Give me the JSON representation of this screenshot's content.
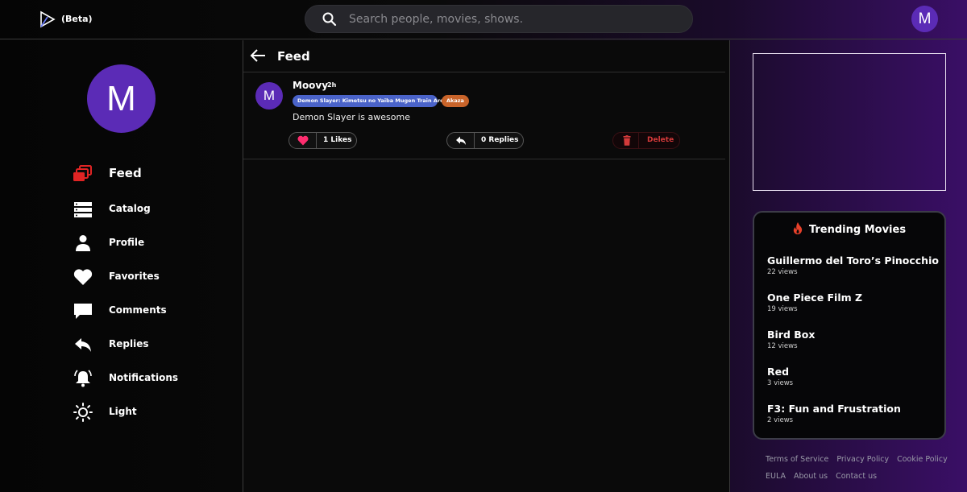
{
  "header": {
    "beta_label": "(Beta)",
    "search_placeholder": "Search people, movies, shows.",
    "avatar_letter": "M"
  },
  "sidebar": {
    "avatar_letter": "M",
    "items": [
      {
        "label": "Feed",
        "icon": "feed-icon"
      },
      {
        "label": "Catalog",
        "icon": "catalog-icon"
      },
      {
        "label": "Profile",
        "icon": "user-icon"
      },
      {
        "label": "Favorites",
        "icon": "heart-icon"
      },
      {
        "label": "Comments",
        "icon": "comment-icon"
      },
      {
        "label": "Replies",
        "icon": "reply-icon"
      },
      {
        "label": "Notifications",
        "icon": "bell-icon"
      },
      {
        "label": "Light",
        "icon": "sun-icon"
      }
    ]
  },
  "feed": {
    "title": "Feed",
    "post": {
      "avatar_letter": "M",
      "user": "Moovy",
      "time": "2h",
      "movie_tag": "Demon Slayer: Kimetsu no Yaiba Mugen Train Arc",
      "character_tag": "Akaza",
      "text": "Demon Slayer is awesome",
      "likes_label": "1 Likes",
      "replies_label": "0 Replies",
      "delete_label": "Delete"
    }
  },
  "trending": {
    "title": "Trending Movies",
    "items": [
      {
        "name": "Guillermo del Toro’s Pinocchio",
        "views": "22 views"
      },
      {
        "name": "One Piece Film Z",
        "views": "19 views"
      },
      {
        "name": "Bird Box",
        "views": "12 views"
      },
      {
        "name": "Red",
        "views": "3 views"
      },
      {
        "name": "F3: Fun and Frustration",
        "views": "2 views"
      }
    ]
  },
  "footer": {
    "links_row1": [
      "Terms of Service",
      "Privacy Policy",
      "Cookie Policy"
    ],
    "links_row2": [
      "EULA",
      "About us",
      "Contact us"
    ]
  },
  "colors": {
    "accent_purple": "#5b2bb6",
    "tag_blue": "#4a63c9",
    "tag_orange": "#c9642a",
    "heart_pink": "#ff2d6f",
    "delete_red": "#d33a3a",
    "fire_red": "#e8402a"
  }
}
